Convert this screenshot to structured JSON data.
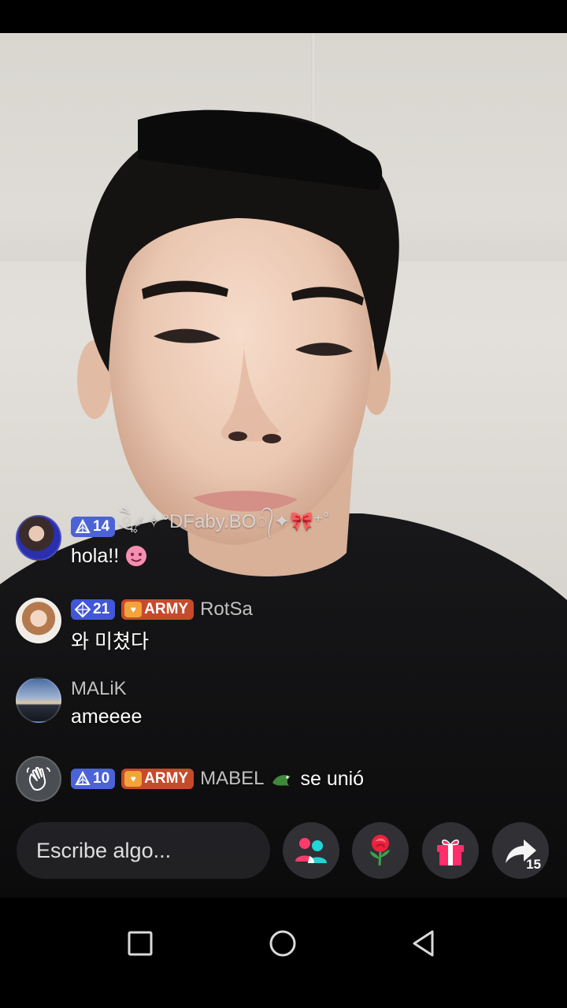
{
  "chat": {
    "messages": [
      {
        "level": "14",
        "username": "ཻུ۪۪⸙͎✧°DFaby.BO᭄✦🎀⁺˚",
        "text": "hola!!"
      },
      {
        "level": "21",
        "fan_badge": "ARMY",
        "username": "RotSa",
        "text": "와 미쳤다"
      },
      {
        "username": "MALiK",
        "text": "ameeee"
      }
    ],
    "join": {
      "level": "10",
      "fan_badge": "ARMY",
      "username": "MABEL",
      "action": "se unió"
    }
  },
  "bottom_bar": {
    "compose_placeholder": "Escribe algo...",
    "buttons": [
      "multi-guest-icon",
      "rose-gift-icon",
      "gift-box-icon",
      "share-icon"
    ],
    "share_count": "15"
  },
  "nav_bar": {
    "buttons": [
      "recents-icon",
      "home-icon",
      "back-icon"
    ]
  },
  "colors": {
    "level_badge": "#4b63d6",
    "army_badge": "#c64a2c",
    "compose_bg": "#28282c",
    "accent_pink": "#ff3b6b",
    "accent_cyan": "#22d3d8"
  }
}
